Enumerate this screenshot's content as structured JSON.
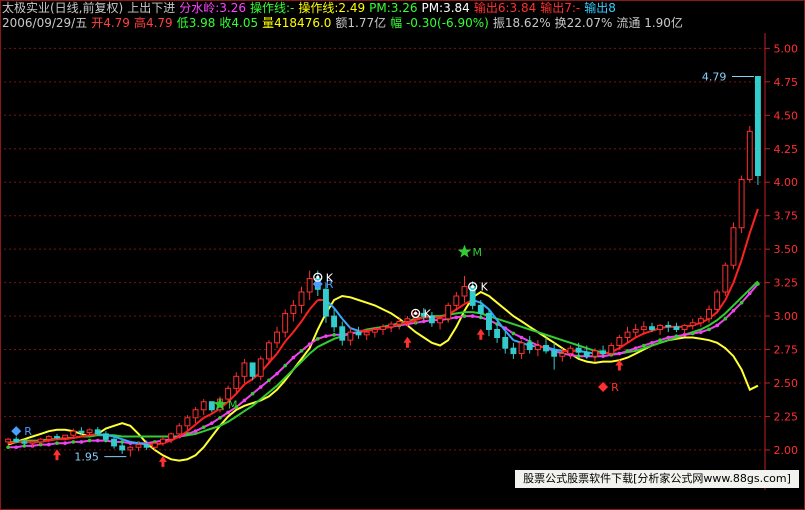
{
  "header": {
    "line1": [
      {
        "text": "太极实业(日线,前复权)",
        "color": "#c8c8c8"
      },
      {
        "text": "上出下进",
        "color": "#c8c8c8"
      },
      {
        "text": "分水岭:3.26",
        "color": "#ff44ff"
      },
      {
        "text": "操作线:-",
        "color": "#33ff33"
      },
      {
        "text": "操作线:2.49",
        "color": "#ffff00"
      },
      {
        "text": "PM:3.26",
        "color": "#33ff33"
      },
      {
        "text": "PM:3.84",
        "color": "#ffffff"
      },
      {
        "text": "输出6:3.84",
        "color": "#ff3030"
      },
      {
        "text": "输出7:-",
        "color": "#ff3030"
      },
      {
        "text": "输出8",
        "color": "#33ccff"
      }
    ],
    "line2": [
      {
        "text": "2006/09/29/五",
        "color": "#c8c8c8"
      },
      {
        "text": "开4.79",
        "color": "#ff4040"
      },
      {
        "text": "高4.79",
        "color": "#ff4040"
      },
      {
        "text": "低3.98",
        "color": "#33ff33"
      },
      {
        "text": "收4.05",
        "color": "#33ff33"
      },
      {
        "text": "量418476.0",
        "color": "#ffff00"
      },
      {
        "text": "额1.77亿",
        "color": "#c8c8c8"
      },
      {
        "text": "幅 -0.30(-6.90%)",
        "color": "#33ff33"
      },
      {
        "text": "振18.62%",
        "color": "#c8c8c8"
      },
      {
        "text": "换22.07%",
        "color": "#c8c8c8"
      },
      {
        "text": "流通 1.90亿",
        "color": "#c8c8c8"
      }
    ]
  },
  "chart_data": {
    "type": "candlestick",
    "y_ticks": [
      "5.00",
      "4.75",
      "4.50",
      "4.25",
      "4.00",
      "3.75",
      "3.50",
      "3.25",
      "3.00",
      "2.75",
      "2.50",
      "2.25",
      "2.00"
    ],
    "ylim": [
      1.85,
      5.1
    ],
    "grid": "horizontal dashed",
    "candles": [
      [
        2.06,
        2.09,
        2.04,
        2.08
      ],
      [
        2.08,
        2.1,
        2.05,
        2.06
      ],
      [
        2.06,
        2.08,
        2.03,
        2.05
      ],
      [
        2.05,
        2.07,
        2.02,
        2.06
      ],
      [
        2.06,
        2.09,
        2.04,
        2.08
      ],
      [
        2.08,
        2.11,
        2.06,
        2.1
      ],
      [
        2.1,
        2.12,
        2.08,
        2.09
      ],
      [
        2.09,
        2.11,
        2.07,
        2.11
      ],
      [
        2.11,
        2.16,
        2.09,
        2.14
      ],
      [
        2.14,
        2.17,
        2.11,
        2.13
      ],
      [
        2.13,
        2.16,
        2.1,
        2.15
      ],
      [
        2.15,
        2.17,
        2.11,
        2.12
      ],
      [
        2.12,
        2.14,
        2.06,
        2.08
      ],
      [
        2.08,
        2.1,
        2.01,
        2.03
      ],
      [
        2.03,
        2.06,
        1.97,
        2.0
      ],
      [
        2.0,
        2.03,
        1.95,
        2.02
      ],
      [
        2.02,
        2.06,
        1.99,
        2.04
      ],
      [
        2.04,
        2.07,
        2.0,
        2.02
      ],
      [
        2.02,
        2.06,
        2.0,
        2.05
      ],
      [
        2.05,
        2.1,
        2.03,
        2.08
      ],
      [
        2.08,
        2.13,
        2.05,
        2.12
      ],
      [
        2.12,
        2.2,
        2.1,
        2.18
      ],
      [
        2.18,
        2.26,
        2.15,
        2.24
      ],
      [
        2.24,
        2.32,
        2.2,
        2.3
      ],
      [
        2.3,
        2.38,
        2.26,
        2.36
      ],
      [
        2.36,
        2.34,
        2.28,
        2.3
      ],
      [
        2.3,
        2.4,
        2.28,
        2.38
      ],
      [
        2.38,
        2.48,
        2.35,
        2.46
      ],
      [
        2.46,
        2.58,
        2.42,
        2.55
      ],
      [
        2.55,
        2.68,
        2.5,
        2.65
      ],
      [
        2.65,
        2.6,
        2.52,
        2.55
      ],
      [
        2.55,
        2.7,
        2.52,
        2.68
      ],
      [
        2.68,
        2.82,
        2.64,
        2.8
      ],
      [
        2.8,
        2.92,
        2.76,
        2.88
      ],
      [
        2.88,
        3.05,
        2.84,
        3.02
      ],
      [
        3.02,
        3.12,
        2.96,
        3.08
      ],
      [
        3.08,
        3.22,
        3.02,
        3.18
      ],
      [
        3.18,
        3.34,
        3.12,
        3.28
      ],
      [
        3.28,
        3.34,
        3.15,
        3.2
      ],
      [
        3.2,
        3.25,
        2.95,
        3.0
      ],
      [
        3.0,
        3.05,
        2.88,
        2.92
      ],
      [
        2.92,
        2.96,
        2.78,
        2.82
      ],
      [
        2.82,
        2.92,
        2.78,
        2.88
      ],
      [
        2.88,
        2.92,
        2.83,
        2.86
      ],
      [
        2.86,
        2.9,
        2.82,
        2.88
      ],
      [
        2.88,
        2.92,
        2.84,
        2.9
      ],
      [
        2.9,
        2.94,
        2.86,
        2.92
      ],
      [
        2.92,
        2.96,
        2.88,
        2.94
      ],
      [
        2.94,
        2.98,
        2.9,
        2.96
      ],
      [
        2.96,
        3.0,
        2.92,
        2.98
      ],
      [
        2.98,
        3.05,
        2.94,
        3.02
      ],
      [
        3.02,
        3.06,
        2.97,
        3.0
      ],
      [
        3.0,
        3.03,
        2.92,
        2.95
      ],
      [
        2.95,
        3.0,
        2.9,
        2.98
      ],
      [
        2.98,
        3.1,
        2.95,
        3.08
      ],
      [
        3.08,
        3.18,
        3.04,
        3.15
      ],
      [
        3.15,
        3.3,
        3.1,
        3.22
      ],
      [
        3.22,
        3.26,
        3.05,
        3.08
      ],
      [
        3.08,
        3.12,
        2.98,
        3.02
      ],
      [
        3.02,
        3.05,
        2.85,
        2.9
      ],
      [
        2.9,
        2.95,
        2.8,
        2.84
      ],
      [
        2.84,
        2.88,
        2.72,
        2.76
      ],
      [
        2.76,
        2.8,
        2.68,
        2.72
      ],
      [
        2.72,
        2.82,
        2.68,
        2.8
      ],
      [
        2.8,
        2.85,
        2.72,
        2.75
      ],
      [
        2.75,
        2.82,
        2.7,
        2.78
      ],
      [
        2.78,
        2.84,
        2.72,
        2.74
      ],
      [
        2.74,
        2.8,
        2.6,
        2.7
      ],
      [
        2.7,
        2.76,
        2.66,
        2.72
      ],
      [
        2.72,
        2.78,
        2.68,
        2.76
      ],
      [
        2.76,
        2.8,
        2.7,
        2.73
      ],
      [
        2.73,
        2.78,
        2.68,
        2.7
      ],
      [
        2.7,
        2.76,
        2.66,
        2.74
      ],
      [
        2.74,
        2.78,
        2.7,
        2.72
      ],
      [
        2.72,
        2.8,
        2.7,
        2.78
      ],
      [
        2.78,
        2.86,
        2.75,
        2.84
      ],
      [
        2.84,
        2.92,
        2.8,
        2.88
      ],
      [
        2.88,
        2.94,
        2.84,
        2.9
      ],
      [
        2.9,
        2.96,
        2.86,
        2.92
      ],
      [
        2.92,
        2.95,
        2.88,
        2.9
      ],
      [
        2.9,
        2.94,
        2.86,
        2.93
      ],
      [
        2.93,
        2.96,
        2.88,
        2.92
      ],
      [
        2.92,
        2.95,
        2.88,
        2.9
      ],
      [
        2.9,
        2.94,
        2.87,
        2.93
      ],
      [
        2.93,
        2.98,
        2.9,
        2.95
      ],
      [
        2.95,
        3.0,
        2.92,
        2.98
      ],
      [
        2.98,
        3.08,
        2.95,
        3.05
      ],
      [
        3.05,
        3.2,
        3.02,
        3.18
      ],
      [
        3.18,
        3.4,
        3.15,
        3.38
      ],
      [
        3.38,
        3.7,
        3.35,
        3.66
      ],
      [
        3.66,
        4.05,
        3.62,
        4.02
      ],
      [
        4.02,
        4.42,
        4.0,
        4.38
      ],
      [
        4.79,
        4.79,
        3.98,
        4.05
      ]
    ],
    "ma_red": [
      2.05,
      2.06,
      2.06,
      2.06,
      2.06,
      2.07,
      2.08,
      2.08,
      2.09,
      2.1,
      2.11,
      2.12,
      2.11,
      2.1,
      2.08,
      2.06,
      2.05,
      2.04,
      2.04,
      2.05,
      2.07,
      2.1,
      2.14,
      2.19,
      2.24,
      2.27,
      2.31,
      2.36,
      2.42,
      2.49,
      2.53,
      2.58,
      2.65,
      2.72,
      2.81,
      2.88,
      2.96,
      3.05,
      3.12,
      3.12,
      3.06,
      2.98,
      2.91,
      2.89,
      2.89,
      2.9,
      2.91,
      2.92,
      2.94,
      2.95,
      2.97,
      2.99,
      2.99,
      2.99,
      3.01,
      3.05,
      3.09,
      3.12,
      3.1,
      3.05,
      2.97,
      2.89,
      2.82,
      2.8,
      2.78,
      2.77,
      2.77,
      2.75,
      2.74,
      2.74,
      2.74,
      2.73,
      2.72,
      2.72,
      2.73,
      2.76,
      2.8,
      2.84,
      2.87,
      2.89,
      2.91,
      2.92,
      2.92,
      2.92,
      2.93,
      2.95,
      2.98,
      3.03,
      3.12,
      3.25,
      3.42,
      3.62,
      3.8
    ],
    "ma_green": [
      2.06,
      2.06,
      2.07,
      2.07,
      2.07,
      2.08,
      2.08,
      2.09,
      2.09,
      2.1,
      2.1,
      2.11,
      2.11,
      2.11,
      2.1,
      2.1,
      2.1,
      2.1,
      2.1,
      2.1,
      2.1,
      2.1,
      2.11,
      2.12,
      2.14,
      2.16,
      2.18,
      2.21,
      2.25,
      2.29,
      2.33,
      2.38,
      2.43,
      2.48,
      2.54,
      2.6,
      2.66,
      2.72,
      2.77,
      2.8,
      2.83,
      2.85,
      2.87,
      2.88,
      2.9,
      2.91,
      2.92,
      2.93,
      2.95,
      2.96,
      2.98,
      2.99,
      3.0,
      3.0,
      3.01,
      3.02,
      3.03,
      3.03,
      3.02,
      3.0,
      2.98,
      2.96,
      2.94,
      2.92,
      2.9,
      2.88,
      2.86,
      2.84,
      2.82,
      2.8,
      2.78,
      2.76,
      2.74,
      2.73,
      2.72,
      2.72,
      2.73,
      2.74,
      2.76,
      2.78,
      2.8,
      2.82,
      2.84,
      2.86,
      2.88,
      2.9,
      2.93,
      2.97,
      3.02,
      3.08,
      3.14,
      3.2,
      3.26
    ],
    "ma_magenta": [
      2.02,
      2.02,
      2.03,
      2.03,
      2.04,
      2.04,
      2.05,
      2.05,
      2.06,
      2.06,
      2.07,
      2.07,
      2.07,
      2.06,
      2.06,
      2.05,
      2.05,
      2.05,
      2.06,
      2.07,
      2.08,
      2.1,
      2.12,
      2.14,
      2.17,
      2.2,
      2.24,
      2.28,
      2.32,
      2.37,
      2.42,
      2.47,
      2.52,
      2.57,
      2.63,
      2.69,
      2.74,
      2.79,
      2.83,
      2.85,
      2.86,
      2.86,
      2.87,
      2.88,
      2.89,
      2.9,
      2.91,
      2.92,
      2.93,
      2.94,
      2.95,
      2.96,
      2.97,
      2.97,
      2.98,
      2.99,
      3.0,
      3.0,
      2.99,
      2.97,
      2.94,
      2.91,
      2.87,
      2.84,
      2.81,
      2.78,
      2.76,
      2.74,
      2.72,
      2.71,
      2.7,
      2.7,
      2.7,
      2.7,
      2.71,
      2.72,
      2.74,
      2.76,
      2.78,
      2.8,
      2.82,
      2.84,
      2.85,
      2.86,
      2.87,
      2.88,
      2.9,
      2.93,
      2.98,
      3.04,
      3.1,
      3.17,
      3.24
    ],
    "ma_yellow": [
      2.04,
      2.06,
      2.08,
      2.1,
      2.12,
      2.14,
      2.15,
      2.15,
      2.14,
      2.12,
      2.1,
      2.12,
      2.16,
      2.18,
      2.2,
      2.18,
      2.12,
      2.05,
      2.0,
      1.96,
      1.93,
      1.92,
      1.93,
      1.96,
      2.02,
      2.1,
      2.18,
      2.25,
      2.3,
      2.33,
      2.35,
      2.37,
      2.4,
      2.45,
      2.52,
      2.6,
      2.68,
      2.76,
      2.9,
      3.02,
      3.12,
      3.15,
      3.14,
      3.12,
      3.1,
      3.08,
      3.05,
      3.02,
      2.98,
      2.93,
      2.88,
      2.84,
      2.8,
      2.78,
      2.82,
      2.92,
      3.04,
      3.14,
      3.18,
      3.15,
      3.1,
      3.05,
      3.0,
      2.96,
      2.92,
      2.88,
      2.84,
      2.8,
      2.76,
      2.72,
      2.68,
      2.66,
      2.65,
      2.66,
      2.66,
      2.67,
      2.69,
      2.72,
      2.75,
      2.78,
      2.8,
      2.82,
      2.83,
      2.84,
      2.84,
      2.83,
      2.82,
      2.8,
      2.76,
      2.7,
      2.6,
      2.45,
      2.48
    ],
    "annotations": [
      {
        "text": "4.79",
        "x": 92,
        "y": 4.79,
        "color": "#87cefa"
      },
      {
        "text": "1.95",
        "x": 15,
        "y": 1.95,
        "color": "#87cefa"
      },
      {
        "text": "M",
        "x": 26,
        "y": 2.34,
        "color": "#33cc33",
        "symbol": "star"
      },
      {
        "text": "M",
        "x": 56,
        "y": 3.48,
        "color": "#33cc33",
        "symbol": "star"
      },
      {
        "text": "R",
        "x": 1,
        "y": 2.14,
        "color": "#4a9cff",
        "symbol": "diamond"
      },
      {
        "text": "R",
        "x": 38,
        "y": 3.24,
        "color": "#4a9cff",
        "symbol": "diamond"
      },
      {
        "text": "R",
        "x": 73,
        "y": 2.47,
        "color": "#ff3030",
        "symbol": "diamond"
      },
      {
        "text": "K",
        "x": 38,
        "y": 3.29,
        "color": "#ffffff",
        "symbol": "circle"
      },
      {
        "text": "K",
        "x": 50,
        "y": 3.02,
        "color": "#ffffff",
        "symbol": "circle"
      },
      {
        "text": "K",
        "x": 57,
        "y": 3.22,
        "color": "#ffffff",
        "symbol": "circle"
      }
    ],
    "arrows_up": [
      6,
      19,
      49,
      58,
      75
    ],
    "colors": {
      "up": "#ff3030",
      "down": "#33cccc",
      "axis": "#c02020",
      "grid": "#7a1212",
      "ma_red": "#ff2020",
      "ma_green": "#33cc33",
      "ma_magenta": "#ee44ee",
      "ma_yellow": "#ffff33",
      "ma_blue": "#33aaff"
    }
  },
  "footer": {
    "text": "股票公式股票软件下载[分析家公式网www.88gs.com]"
  }
}
